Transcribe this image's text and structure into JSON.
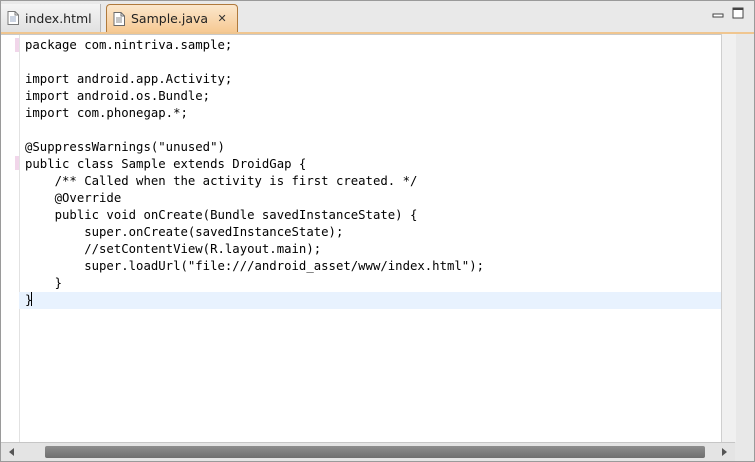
{
  "tabs": [
    {
      "label": "index.html",
      "active": false,
      "icon": "html-file-icon"
    },
    {
      "label": "Sample.java",
      "active": true,
      "icon": "java-file-icon",
      "close_glyph": "✕"
    }
  ],
  "window_controls": {
    "minimize_glyph": "▭",
    "maximize_glyph": "▭"
  },
  "editor": {
    "lines": [
      "package com.nintriva.sample;",
      "",
      "import android.app.Activity;",
      "import android.os.Bundle;",
      "import com.phonegap.*;",
      "",
      "@SuppressWarnings(\"unused\")",
      "public class Sample extends DroidGap {",
      "    /** Called when the activity is first created. */",
      "    @Override",
      "    public void onCreate(Bundle savedInstanceState) {",
      "        super.onCreate(savedInstanceState);",
      "        //setContentView(R.layout.main);",
      "        super.loadUrl(\"file:///android_asset/www/index.html\");",
      "    }",
      "}"
    ],
    "current_line": 16
  },
  "colors": {
    "active_tab": "#f6c993",
    "current_line_highlight": "#e8f2fe",
    "marker": "#f1d6ea"
  }
}
